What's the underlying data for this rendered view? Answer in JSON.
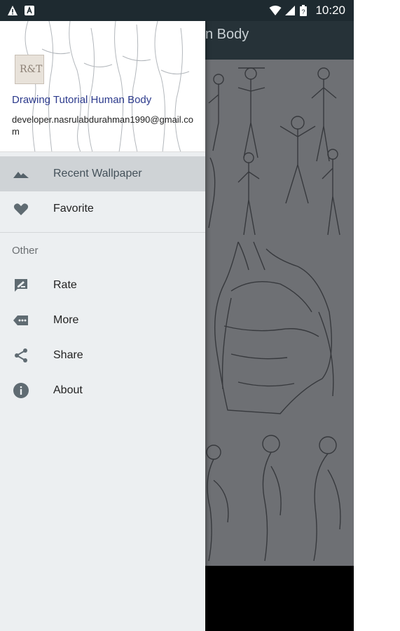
{
  "status_bar": {
    "time": "10:20",
    "left_icons": [
      "warning-icon",
      "notification-a-icon"
    ],
    "right_icons": [
      "wifi-icon",
      "cellular-icon",
      "battery-icon"
    ]
  },
  "app_bar": {
    "title_partial": "n Body"
  },
  "drawer": {
    "header": {
      "title": "Drawing Tutorial Human Body",
      "email": "developer.nasrulabdurahman1990@gmail.com",
      "avatar_text": "R&T"
    },
    "items": [
      {
        "label": "Recent Wallpaper",
        "icon": "landscape-icon",
        "active": true
      },
      {
        "label": "Favorite",
        "icon": "heart-icon",
        "active": false
      }
    ],
    "section_title": "Other",
    "other_items": [
      {
        "label": "Rate",
        "icon": "rate-review-icon"
      },
      {
        "label": "More",
        "icon": "more-icon"
      },
      {
        "label": "Share",
        "icon": "share-icon"
      },
      {
        "label": "About",
        "icon": "info-icon"
      }
    ]
  },
  "colors": {
    "status_bar": "#1e2a30",
    "app_bar": "#263238",
    "drawer_bg": "#eceff1",
    "active_item": "#cfd3d6",
    "header_title": "#2c3a8c",
    "icon": "#5f6b72"
  }
}
